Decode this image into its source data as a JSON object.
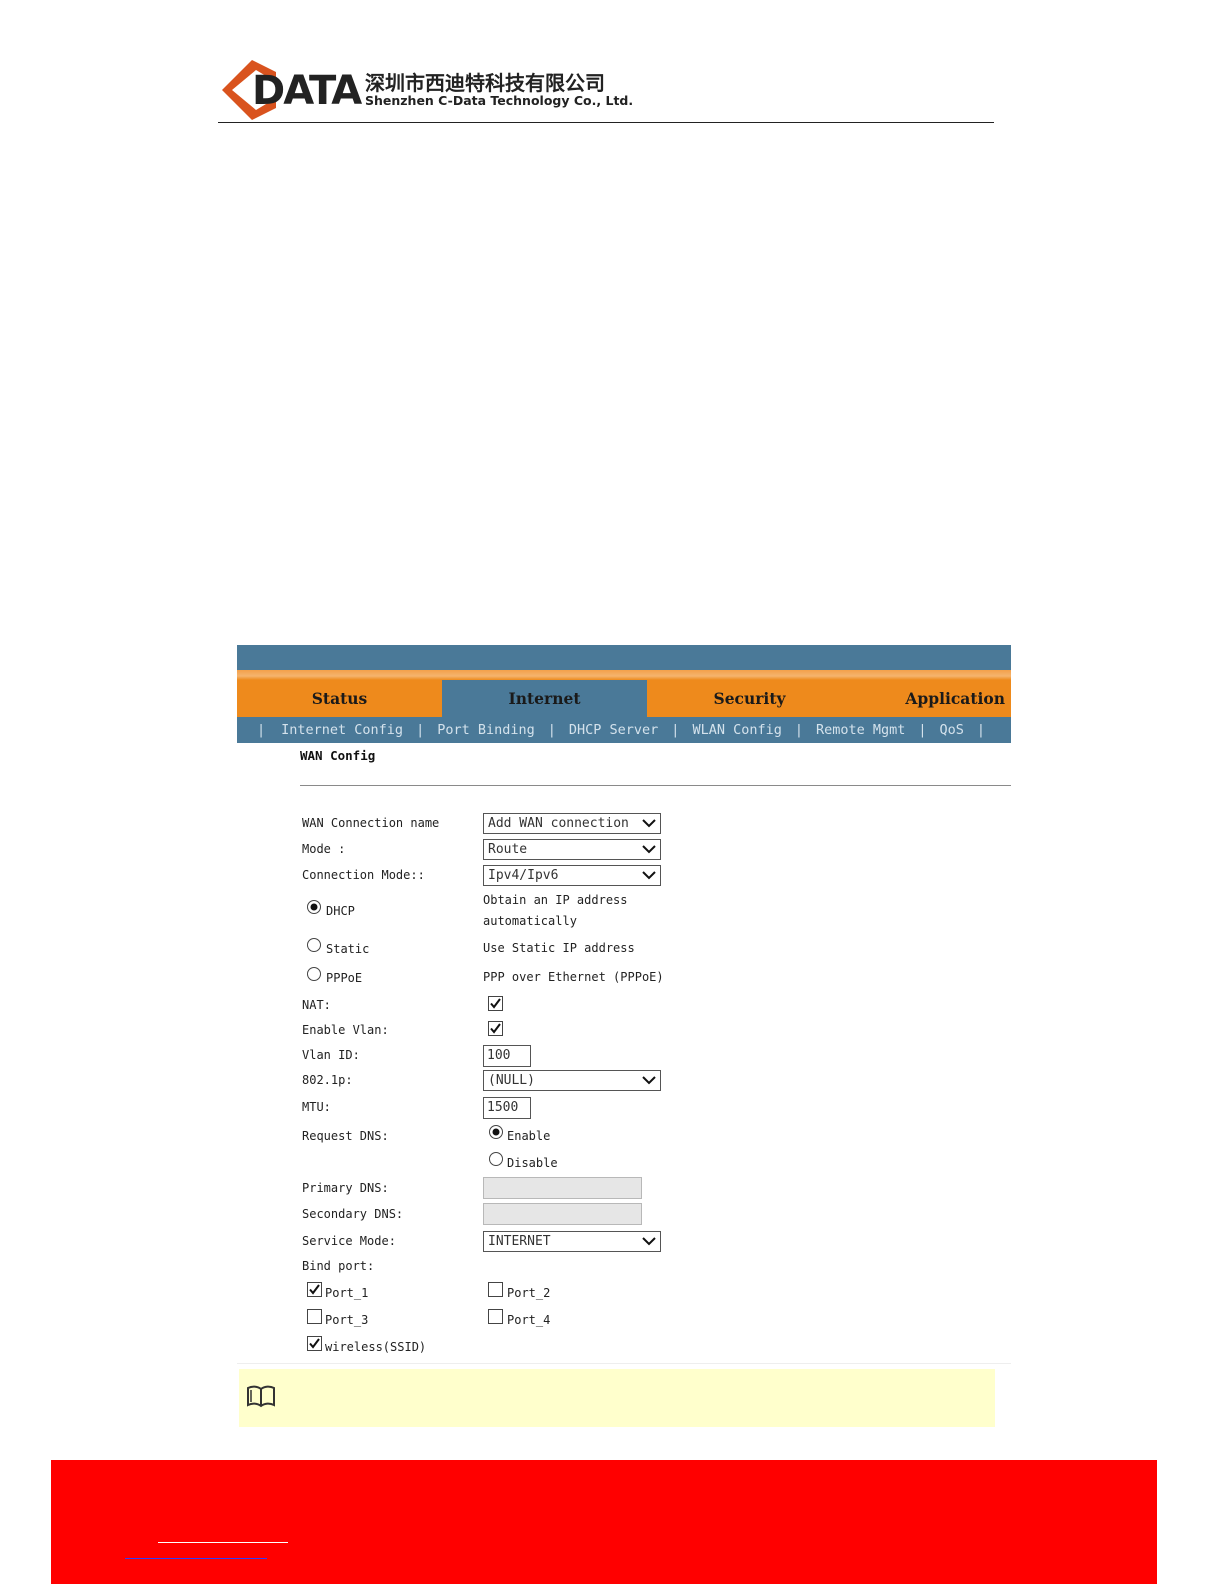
{
  "header": {
    "logo_word": "DATA",
    "company_cn": "深圳市西迪特科技有限公司",
    "company_en": "Shenzhen C-Data Technology Co., Ltd.",
    "brand_color": "#d9531e"
  },
  "router_ui": {
    "nav_tabs": [
      {
        "label": "Status",
        "active": false
      },
      {
        "label": "Internet",
        "active": true
      },
      {
        "label": "Security",
        "active": false
      },
      {
        "label": "Application",
        "active": false
      }
    ],
    "sub_nav": [
      "Internet Config",
      "Port Binding",
      "DHCP Server",
      "WLAN Config",
      "Remote Mgmt",
      "QoS"
    ],
    "colors": {
      "nav_orange": "#ee8a1c",
      "nav_blue": "#4a7998",
      "note_bg": "#ffffcc"
    },
    "section_title": "WAN Config",
    "form": {
      "wan_connection_name": {
        "label": "WAN Connection name",
        "value": "Add WAN connection"
      },
      "mode": {
        "label": "Mode :",
        "value": "Route"
      },
      "connection_mode": {
        "label": "Connection Mode::",
        "value": "Ipv4/Ipv6"
      },
      "ip_modes": [
        {
          "label": "DHCP",
          "desc_line1": "Obtain an IP address",
          "desc_line2": "automatically",
          "selected": true
        },
        {
          "label": "Static",
          "desc_line1": "Use Static IP address",
          "selected": false
        },
        {
          "label": "PPPoE",
          "desc_line1": "PPP over Ethernet (PPPoE)",
          "selected": false
        }
      ],
      "nat": {
        "label": "NAT:",
        "checked": true
      },
      "enable_vlan": {
        "label": "Enable Vlan:",
        "checked": true
      },
      "vlan_id": {
        "label": "Vlan ID:",
        "value": "100"
      },
      "dot1p": {
        "label": "802.1p:",
        "value": "(NULL)"
      },
      "mtu": {
        "label": "MTU:",
        "value": "1500"
      },
      "request_dns": {
        "label": "Request DNS:",
        "options": [
          {
            "label": "Enable",
            "selected": true
          },
          {
            "label": "Disable",
            "selected": false
          }
        ]
      },
      "primary_dns": {
        "label": "Primary DNS:",
        "value": ""
      },
      "secondary_dns": {
        "label": "Secondary DNS:",
        "value": ""
      },
      "service_mode": {
        "label": "Service Mode:",
        "value": "INTERNET"
      },
      "bind_port": {
        "label": "Bind port:",
        "ports": [
          {
            "label": "Port_1",
            "checked": true
          },
          {
            "label": "Port_2",
            "checked": false
          },
          {
            "label": "Port_3",
            "checked": false
          },
          {
            "label": "Port_4",
            "checked": false
          },
          {
            "label": "wireless(SSID)",
            "checked": true
          }
        ]
      }
    },
    "note_icon": "book-icon"
  },
  "footer": {
    "color": "#ff0000"
  }
}
